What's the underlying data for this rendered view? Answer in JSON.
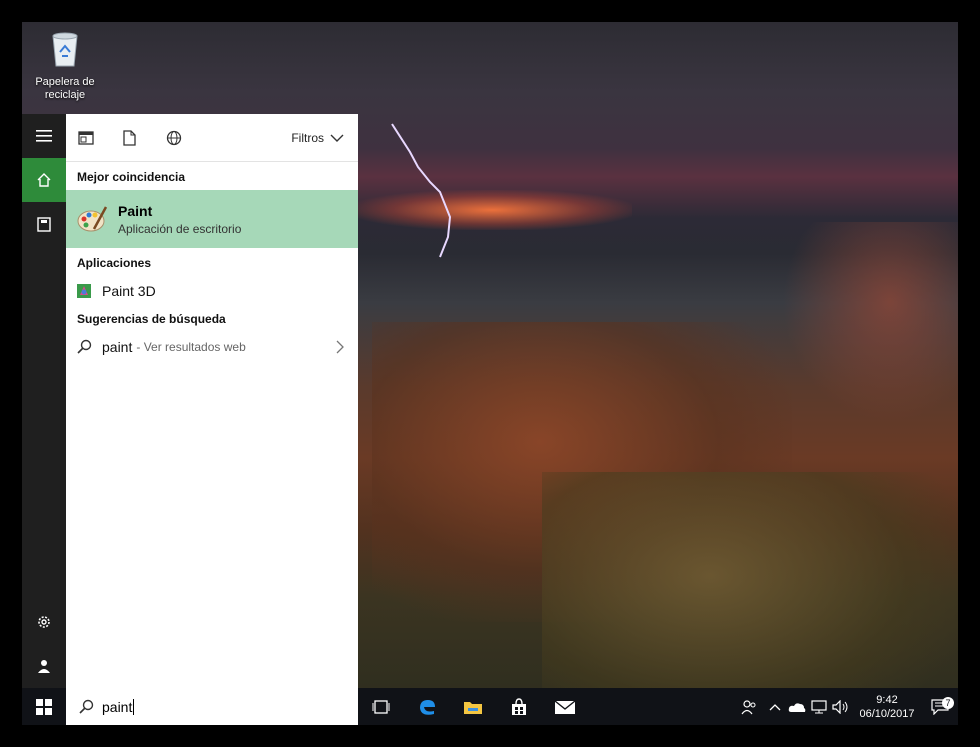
{
  "desktop": {
    "recycle_bin_label_line1": "Papelera de",
    "recycle_bin_label_line2": "reciclaje"
  },
  "search_panel": {
    "filters_label": "Filtros",
    "best_match_header": "Mejor coincidencia",
    "best_match": {
      "name": "Paint",
      "subtitle": "Aplicación de escritorio"
    },
    "apps_header": "Aplicaciones",
    "apps": [
      {
        "name": "Paint 3D"
      }
    ],
    "suggestions_header": "Sugerencias de búsqueda",
    "suggestions": [
      {
        "query": "paint",
        "hint": "- Ver resultados web"
      }
    ]
  },
  "taskbar": {
    "search_value": "paint",
    "clock_time": "9:42",
    "clock_date": "06/10/2017",
    "notification_count": "7"
  },
  "colors": {
    "accent": "#2e8b3a",
    "best_match_bg": "#a6d8b8",
    "taskbar": "#101217"
  }
}
